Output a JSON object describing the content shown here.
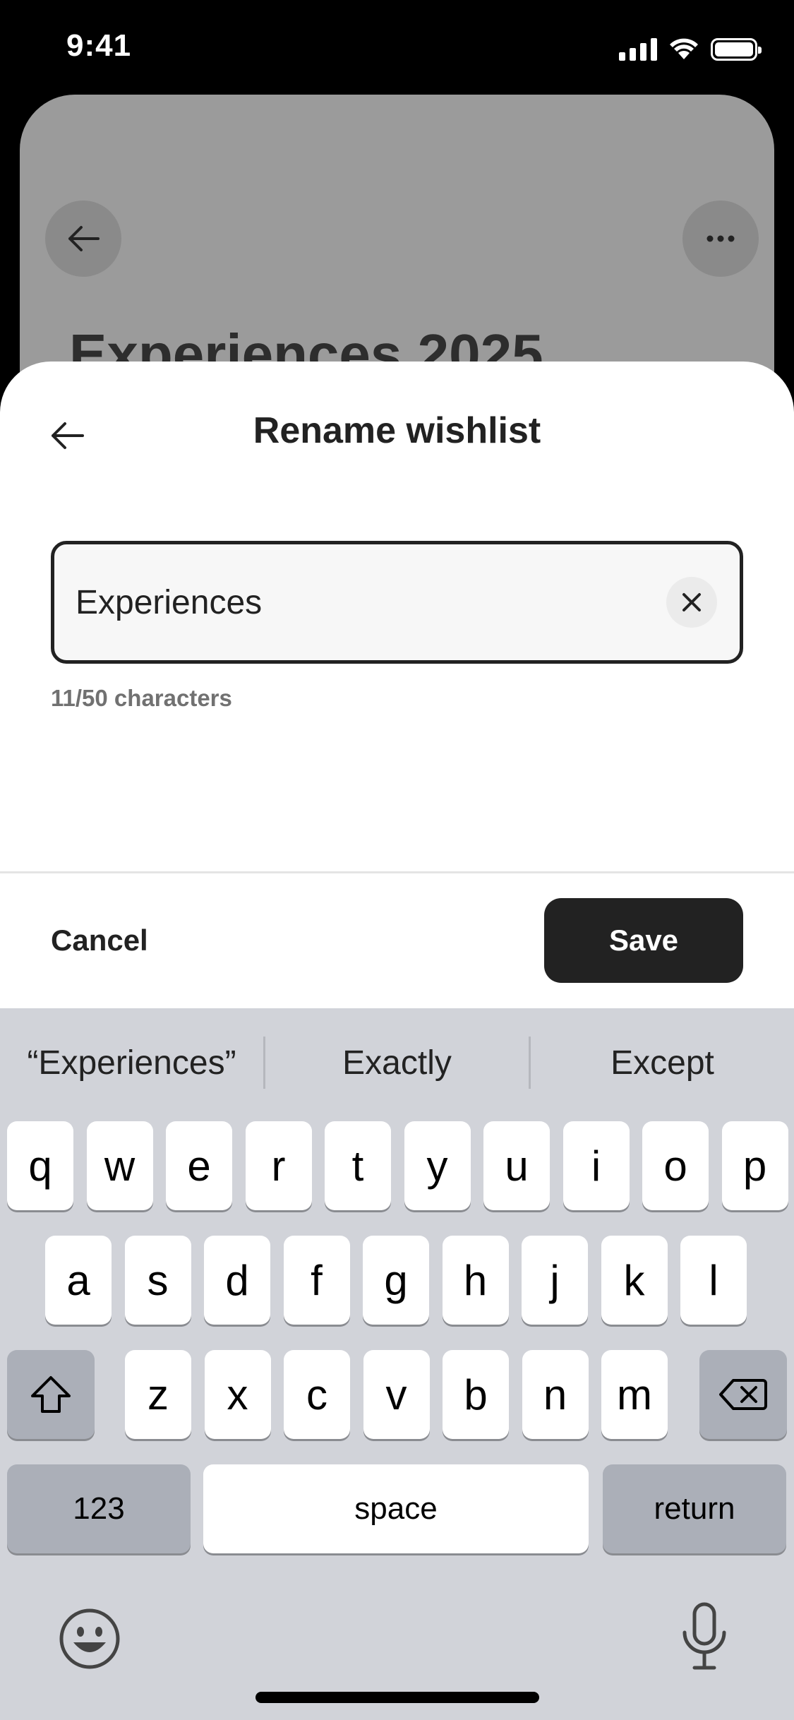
{
  "status_bar": {
    "time": "9:41"
  },
  "background": {
    "title": "Experiences 2025"
  },
  "sheet": {
    "title": "Rename wishlist",
    "input_value": "Experiences",
    "char_count": "11/50 characters",
    "cancel_label": "Cancel",
    "save_label": "Save"
  },
  "keyboard": {
    "predictions": [
      "“Experiences”",
      "Exactly",
      "Except"
    ],
    "row1": [
      "q",
      "w",
      "e",
      "r",
      "t",
      "y",
      "u",
      "i",
      "o",
      "p"
    ],
    "row2": [
      "a",
      "s",
      "d",
      "f",
      "g",
      "h",
      "j",
      "k",
      "l"
    ],
    "row3": [
      "z",
      "x",
      "c",
      "v",
      "b",
      "n",
      "m"
    ],
    "numbers_label": "123",
    "space_label": "space",
    "return_label": "return"
  },
  "icons": {
    "back": "arrow-left-icon",
    "more": "ellipsis-icon",
    "clear": "close-icon",
    "shift": "shift-icon",
    "delete": "backspace-icon",
    "emoji": "emoji-icon",
    "mic": "microphone-icon"
  }
}
